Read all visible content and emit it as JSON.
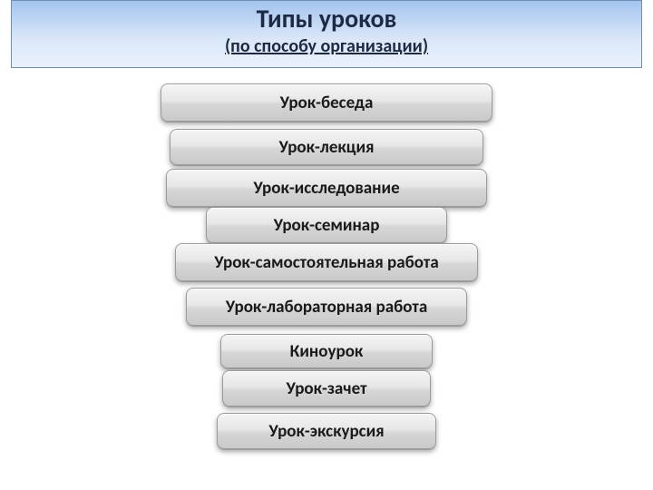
{
  "header": {
    "title": "Типы уроков",
    "subtitle": "(по способу организации)"
  },
  "items": [
    {
      "label": "Урок-беседа"
    },
    {
      "label": "Урок-лекция"
    },
    {
      "label": "Урок-исследование"
    },
    {
      "label": "Урок-семинар"
    },
    {
      "label": "Урок-самостоятельная работа"
    },
    {
      "label": "Урок-лабораторная работа"
    },
    {
      "label": "Киноурок"
    },
    {
      "label": "Урок-зачет"
    },
    {
      "label": "Урок-экскурсия"
    }
  ],
  "colors": {
    "title_bg_top": "#a4c4ee",
    "title_bg_bottom": "#eaf1fb",
    "chip_light": "#f4f4f4",
    "chip_dark": "#c9c9c9",
    "text": "#1a1a1a"
  }
}
